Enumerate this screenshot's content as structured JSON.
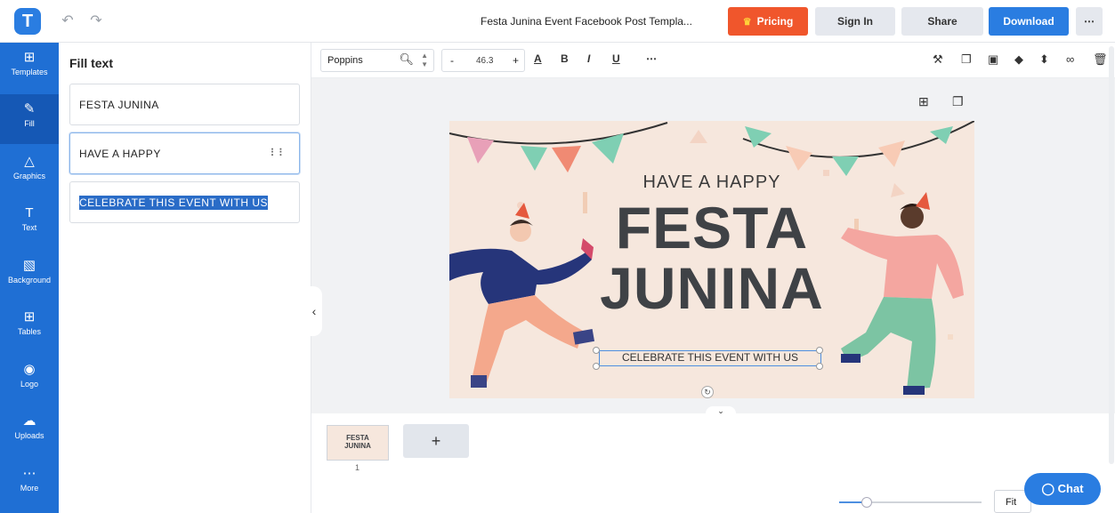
{
  "app": {
    "logo_letter": "T",
    "doc_title": "Festa Junina Event Facebook Post Templa..."
  },
  "header": {
    "pricing_label": "Pricing",
    "signin_label": "Sign In",
    "share_label": "Share",
    "download_label": "Download",
    "more_label": "⋯"
  },
  "rail": {
    "items": [
      {
        "label": "Templates",
        "icon": "⊞"
      },
      {
        "label": "Fill",
        "icon": "✎"
      },
      {
        "label": "Graphics",
        "icon": "△"
      },
      {
        "label": "Text",
        "icon": "T"
      },
      {
        "label": "Background",
        "icon": "▧"
      },
      {
        "label": "Tables",
        "icon": "⊞"
      },
      {
        "label": "Logo",
        "icon": "◉"
      },
      {
        "label": "Uploads",
        "icon": "☁"
      },
      {
        "label": "More",
        "icon": "⋯"
      }
    ]
  },
  "panel": {
    "title": "Fill text",
    "fields": [
      "FESTA JUNINA",
      "HAVE A HAPPY",
      "CELEBRATE THIS EVENT WITH US"
    ]
  },
  "toolbar": {
    "font_name": "Poppins",
    "font_size": "46.3",
    "minus": "-",
    "plus": "+",
    "color_a": "A",
    "bold": "B",
    "italic": "I",
    "underline": "U",
    "more": "⋯"
  },
  "design": {
    "line1": "HAVE A HAPPY",
    "line2": "FESTA",
    "line3": "JUNINA",
    "line4": "CELEBRATE THIS EVENT WITH US"
  },
  "pages": {
    "thumb_line1": "FESTA",
    "thumb_line2": "JUNINA",
    "page_number": "1",
    "add_label": "+"
  },
  "zoom": {
    "fit_label": "Fit"
  },
  "chat": {
    "label": "Chat"
  }
}
